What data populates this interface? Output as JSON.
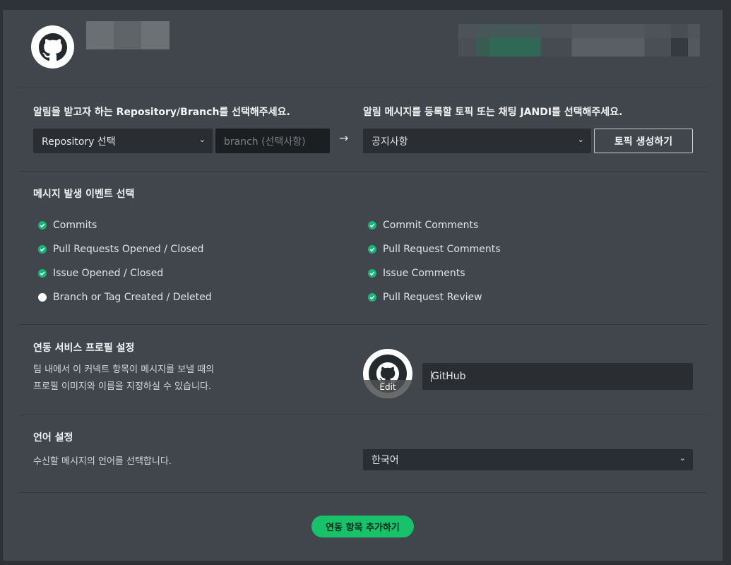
{
  "repository": {
    "heading": "알림을 받고자 하는 Repository/Branch를 선택해주세요.",
    "select_value": "Repository 선택",
    "branch_placeholder": "branch (선택사항)"
  },
  "topic": {
    "heading": "알림 메시지를 등록할 토픽 또는 채팅 JANDI를 선택해주세요.",
    "select_value": "공지사항",
    "create_button": "토픽 생성하기"
  },
  "events": {
    "heading": "메시지 발생 이벤트 선택",
    "left": [
      {
        "label": "Commits",
        "checked": true
      },
      {
        "label": "Pull Requests Opened / Closed",
        "checked": true
      },
      {
        "label": "Issue Opened / Closed",
        "checked": true
      },
      {
        "label": "Branch or Tag Created / Deleted",
        "checked": false
      }
    ],
    "right": [
      {
        "label": "Commit Comments",
        "checked": true
      },
      {
        "label": "Pull Request Comments",
        "checked": true
      },
      {
        "label": "Issue Comments",
        "checked": true
      },
      {
        "label": "Pull Request Review",
        "checked": true
      }
    ]
  },
  "profile": {
    "heading": "연동 서비스 프로필 설정",
    "desc_line1": "팀 내에서 이 커넥트 항목이 메시지를 보낼 때의",
    "desc_line2": "프로필 이미지와 이름을 지정하실 수 있습니다.",
    "edit_label": "Edit",
    "name_value": "GitHub"
  },
  "language": {
    "heading": "언어 설정",
    "desc": "수신할 메시지의 언어를 선택합니다.",
    "select_value": "한국어"
  },
  "add_button": "연동 항목 추가하기",
  "colors": {
    "accent_green": "#17c26b",
    "check_green": "#19b47a",
    "panel_bg": "#40464c"
  },
  "icons": {
    "logo": "github-icon",
    "chevron": "chevron-down-icon",
    "arrow": "arrow-right-icon",
    "check": "check-icon"
  }
}
